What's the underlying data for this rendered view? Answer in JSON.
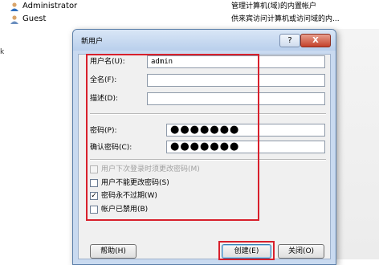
{
  "background_list": [
    {
      "name": "Administrator",
      "description": "管理计算机(域)的内置帐户"
    },
    {
      "name": "Guest",
      "description": "供来宾访问计算机或访问域的内..."
    }
  ],
  "left_mark": "k",
  "dialog": {
    "title": "新用户",
    "help_glyph": "?",
    "close_glyph": "X",
    "fields": {
      "username_label": "用户名(U):",
      "username_value": "admin",
      "fullname_label": "全名(F):",
      "fullname_value": "",
      "description_label": "描述(D):",
      "description_value": "",
      "password_label": "密码(P):",
      "password_value": "●●●●●●●",
      "confirm_label": "确认密码(C):",
      "confirm_value": "●●●●●●●"
    },
    "checkboxes": [
      {
        "label": "用户下次登录时须更改密码(M)",
        "checked": false,
        "disabled": true
      },
      {
        "label": "用户不能更改密码(S)",
        "checked": false,
        "disabled": false
      },
      {
        "label": "密码永不过期(W)",
        "checked": true,
        "disabled": false
      },
      {
        "label": "帐户已禁用(B)",
        "checked": false,
        "disabled": false
      }
    ],
    "buttons": {
      "help": "帮助(H)",
      "create": "创建(E)",
      "close": "关闭(O)"
    }
  },
  "colors": {
    "highlight": "#d8202c",
    "dialog_frame": "#c9daf0"
  }
}
